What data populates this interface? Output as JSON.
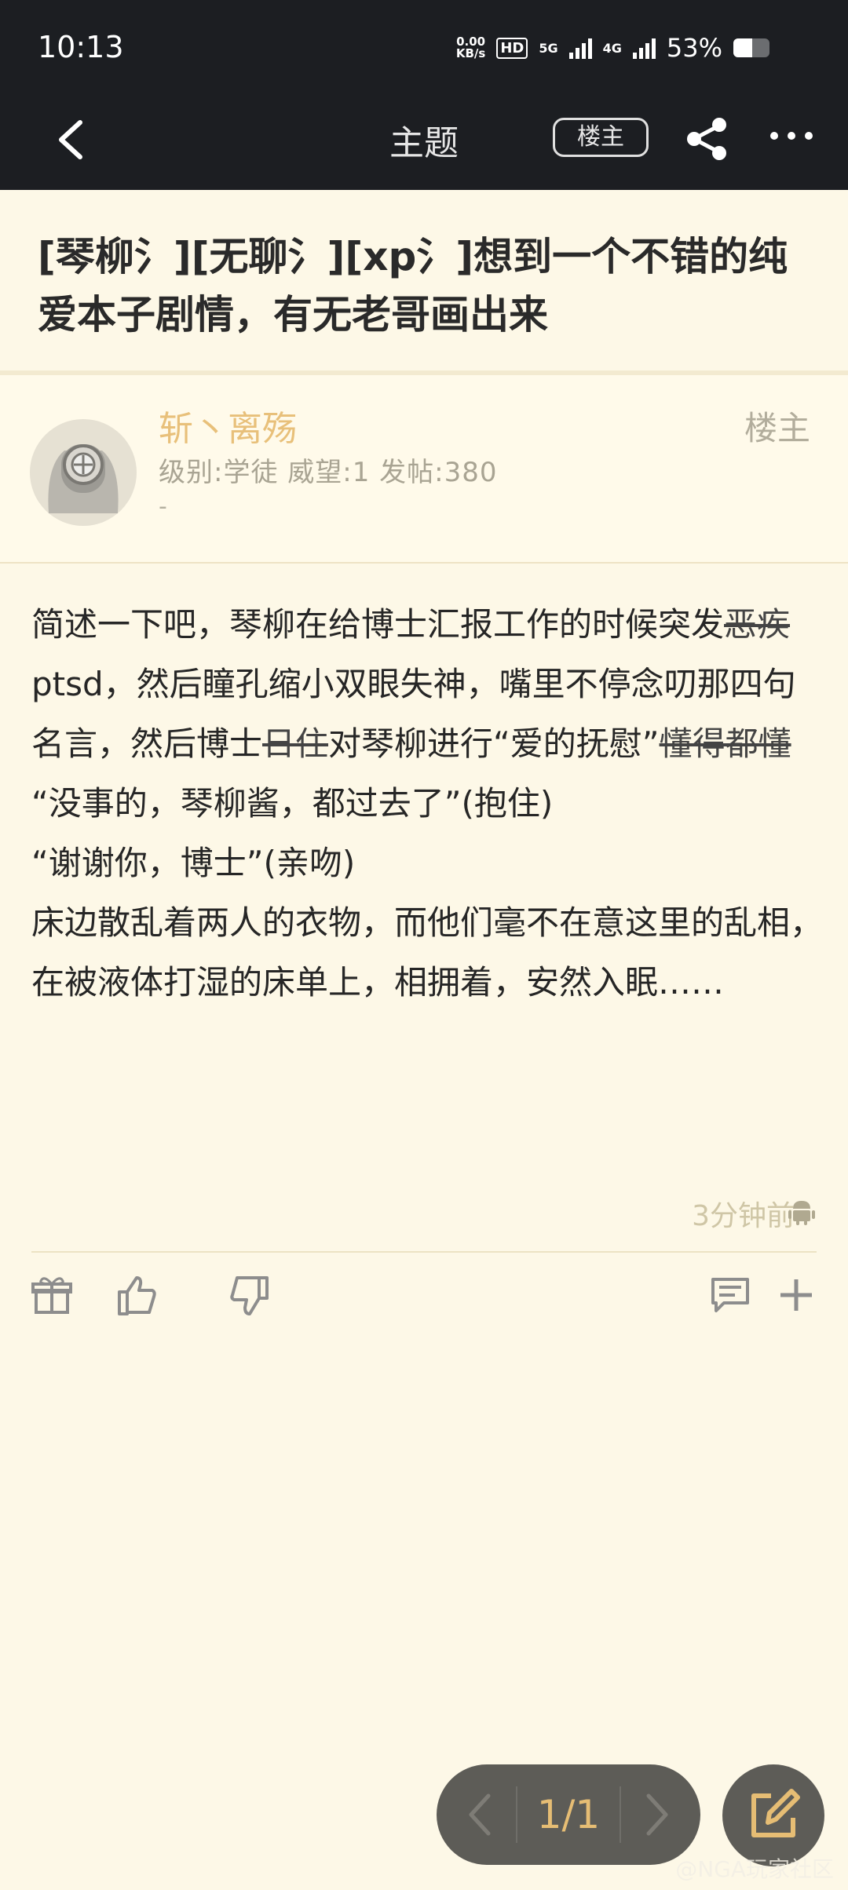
{
  "status_bar": {
    "time": "10:13",
    "net_speed_value": "0.00",
    "net_speed_unit": "KB/s",
    "hd": "HD",
    "net1": "5G",
    "net2": "4G",
    "battery": "53%",
    "battery_level": 0.53
  },
  "app_bar": {
    "title": "主题",
    "op_only_label": "楼主"
  },
  "thread": {
    "title": "[琴柳氵][无聊氵][xp氵]想到一个不错的纯爱本子剧情，有无老哥画出来"
  },
  "post": {
    "author": "斩丶离殇",
    "stats": "级别:学徒 威望:1 发帖:380",
    "signature": "-",
    "op_tag": "楼主",
    "body": {
      "p1_a": "简述一下吧，琴柳在给博士汇报工作的时候突发",
      "p1_s1": "恶疾",
      "p1_b": "ptsd，然后瞳孔缩小双眼失神，嘴里不停念叨那四句名言，然后博士",
      "p1_s2": "日住",
      "p1_c": "对琴柳进行“爱的抚慰”",
      "p1_s3": "懂得都懂",
      "p2": "“没事的，琴柳酱，都过去了”(抱住)",
      "p3": "“谢谢你，博士”(亲吻)",
      "p4": "床边散乱着两人的衣物，而他们毫不在意这里的乱相，在被液体打湿的床单上，相拥着，安然入眠……"
    },
    "time": "3分钟前"
  },
  "pager": {
    "label": "1/1"
  },
  "watermark": "@NGA玩家社区"
}
